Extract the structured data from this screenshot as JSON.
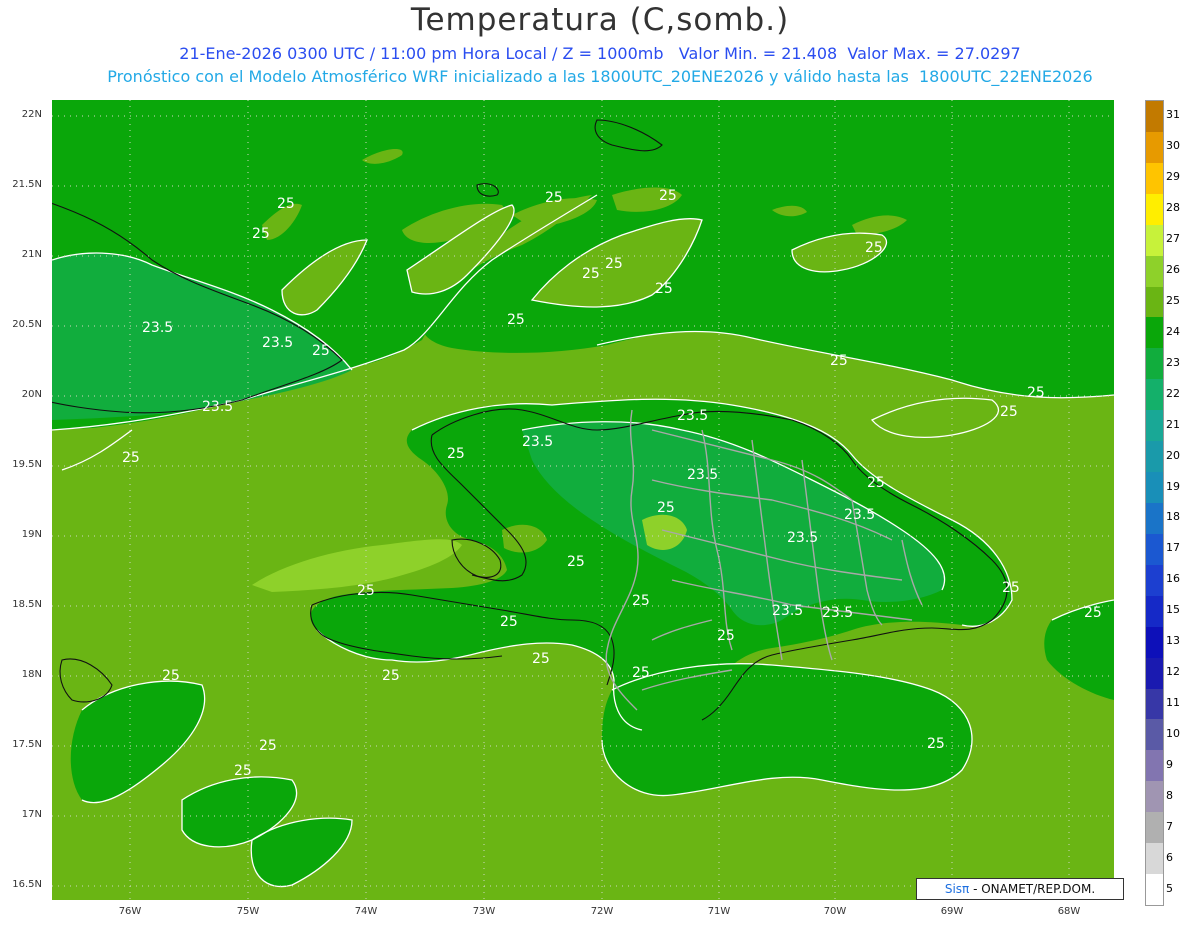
{
  "title": "Temperatura (C,somb.)",
  "subtitle_line1": "21-Ene-2026 0300 UTC / 11:00 pm Hora Local / Z = 1000mb   Valor Min. = 21.408  Valor Max. = 27.0297",
  "subtitle_line2": "Pronóstico con el Modelo Atmosférico WRF inicializado a las 1800UTC_20ENE2026 y válido hasta las  1800UTC_22ENE2026",
  "credit": {
    "sis": "Sisπ",
    "rest": " - ONAMET/REP.DOM."
  },
  "lat_labels": [
    "22N",
    "21.5N",
    "21N",
    "20.5N",
    "20N",
    "19.5N",
    "19N",
    "18.5N",
    "18N",
    "17.5N",
    "17N",
    "16.5N"
  ],
  "lon_labels": [
    "76W",
    "75W",
    "74W",
    "73W",
    "72W",
    "71W",
    "70W",
    "69W",
    "68W"
  ],
  "legend": {
    "labels": [
      "31",
      "30",
      "29",
      "28",
      "27",
      "26",
      "25",
      "24",
      "23",
      "22",
      "21",
      "20",
      "19",
      "18",
      "17",
      "16",
      "15",
      "13",
      "12",
      "11",
      "10",
      "9",
      "8",
      "7",
      "6",
      "5"
    ],
    "colors": [
      "#c27a00",
      "#e79a00",
      "#ffc400",
      "#ffee00",
      "#c7f23a",
      "#8ed12a",
      "#6ab514",
      "#0aa70a",
      "#11ad3d",
      "#14b06a",
      "#19a896",
      "#1a9aaa",
      "#198fb8",
      "#1a74c8",
      "#1b58d1",
      "#1c3fd0",
      "#1529c7",
      "#0d10b9",
      "#1a1ab0",
      "#3737a7",
      "#5a5aa6",
      "#8275b0",
      "#a095b2",
      "#b0b0b0",
      "#d8d8d8",
      "#ffffff"
    ]
  },
  "contour_labels": [
    {
      "text": "25"
    },
    {
      "text": "25"
    },
    {
      "text": "23.5"
    },
    {
      "text": "23.5"
    },
    {
      "text": "25"
    },
    {
      "text": "23.5"
    },
    {
      "text": "25"
    },
    {
      "text": "25"
    },
    {
      "text": "25"
    },
    {
      "text": "25"
    },
    {
      "text": "25"
    },
    {
      "text": "25"
    },
    {
      "text": "25"
    },
    {
      "text": "25"
    },
    {
      "text": "25"
    },
    {
      "text": "25"
    },
    {
      "text": "25"
    },
    {
      "text": "25"
    },
    {
      "text": "23.5"
    },
    {
      "text": "23.5"
    },
    {
      "text": "23.5"
    },
    {
      "text": "25"
    },
    {
      "text": "25"
    },
    {
      "text": "23.5"
    },
    {
      "text": "23.5"
    },
    {
      "text": "23.5"
    },
    {
      "text": "23.5"
    },
    {
      "text": "25"
    },
    {
      "text": "25"
    },
    {
      "text": "25"
    },
    {
      "text": "25"
    },
    {
      "text": "25"
    },
    {
      "text": "25"
    },
    {
      "text": "25"
    },
    {
      "text": "25"
    },
    {
      "text": "25"
    },
    {
      "text": "25"
    },
    {
      "text": "25"
    },
    {
      "text": "25"
    },
    {
      "text": "25"
    },
    {
      "text": "25"
    }
  ]
}
